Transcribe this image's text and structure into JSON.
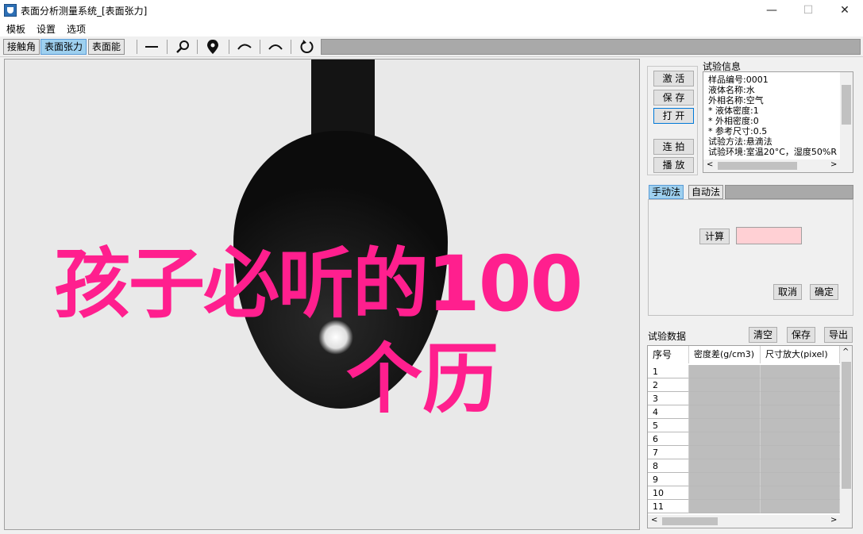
{
  "window": {
    "title": "表面分析测量系统_[表面张力]",
    "minimize": "—",
    "maximize": "☐",
    "close": "✕"
  },
  "menu": [
    "模板",
    "设置",
    "选项"
  ],
  "toolbar": {
    "tabs": [
      "接触角",
      "表面张力",
      "表面能"
    ],
    "active_tab": "表面张力",
    "tools": [
      {
        "icon": "line-icon",
        "glyph": "—"
      },
      {
        "icon": "magnifier-icon",
        "glyph": "⚲"
      },
      {
        "icon": "location-pin-icon",
        "glyph": "⚲"
      },
      {
        "icon": "arc-left-icon",
        "glyph": "⌒"
      },
      {
        "icon": "arc-icon",
        "glyph": "⌒"
      },
      {
        "icon": "rotate-icon",
        "glyph": "↻"
      }
    ]
  },
  "overlay": {
    "line1": "孩子必听的100",
    "line2": "个历",
    "color": "#ff1f8e"
  },
  "controls": {
    "activate": "激 活",
    "save": "保 存",
    "open": "打 开",
    "continuous": "连 拍",
    "play": "播 放"
  },
  "experiment_info": {
    "label": "试验信息",
    "lines": [
      "样品编号:0001",
      "液体名称:水",
      "外相名称:空气",
      "* 液体密度:1",
      "* 外相密度:0",
      "* 参考尺寸:0.5",
      "试验方法:悬滴法",
      "试验环境:室温20°C，湿度50%R"
    ]
  },
  "method_tabs": [
    "手动法",
    "自动法"
  ],
  "method_active": "手动法",
  "manual": {
    "calculate": "计算",
    "result_value": "",
    "cancel": "取消",
    "confirm": "确定"
  },
  "data_section": {
    "label": "试验数据",
    "clear": "清空",
    "save": "保存",
    "export": "导出",
    "columns": [
      "序号",
      "密度差(g/cm3)",
      "尺寸放大(pixel)"
    ],
    "rows": [
      "1",
      "2",
      "3",
      "4",
      "5",
      "6",
      "7",
      "8",
      "9",
      "10",
      "11"
    ]
  }
}
